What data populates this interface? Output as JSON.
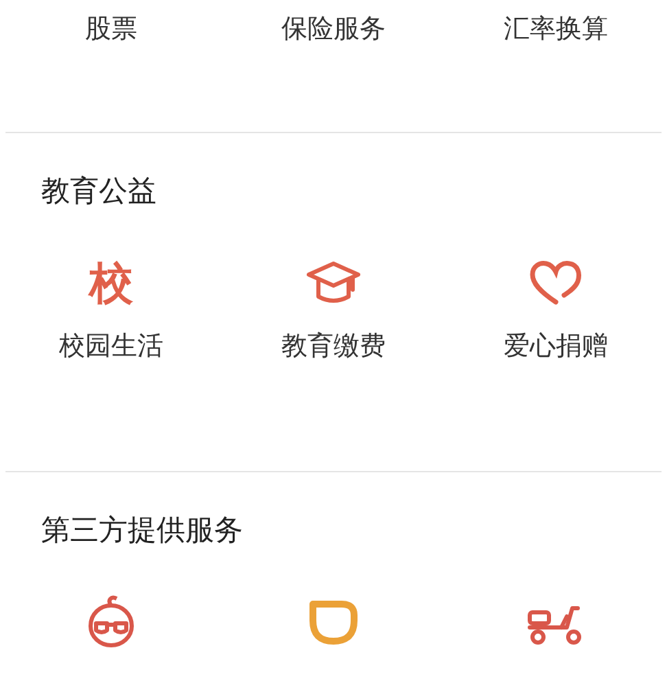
{
  "top_row": {
    "items": [
      {
        "label": "股票"
      },
      {
        "label": "保险服务"
      },
      {
        "label": "汇率换算"
      }
    ]
  },
  "sections": [
    {
      "title": "教育公益",
      "items": [
        {
          "kind": "glyph",
          "glyph": "校",
          "label": "校园生活"
        },
        {
          "kind": "cap",
          "label": "教育缴费"
        },
        {
          "kind": "heart",
          "label": "爱心捐赠"
        }
      ]
    },
    {
      "title": "第三方提供服务",
      "items": [
        {
          "kind": "glasses"
        },
        {
          "kind": "cup"
        },
        {
          "kind": "scooter"
        }
      ]
    }
  ]
}
